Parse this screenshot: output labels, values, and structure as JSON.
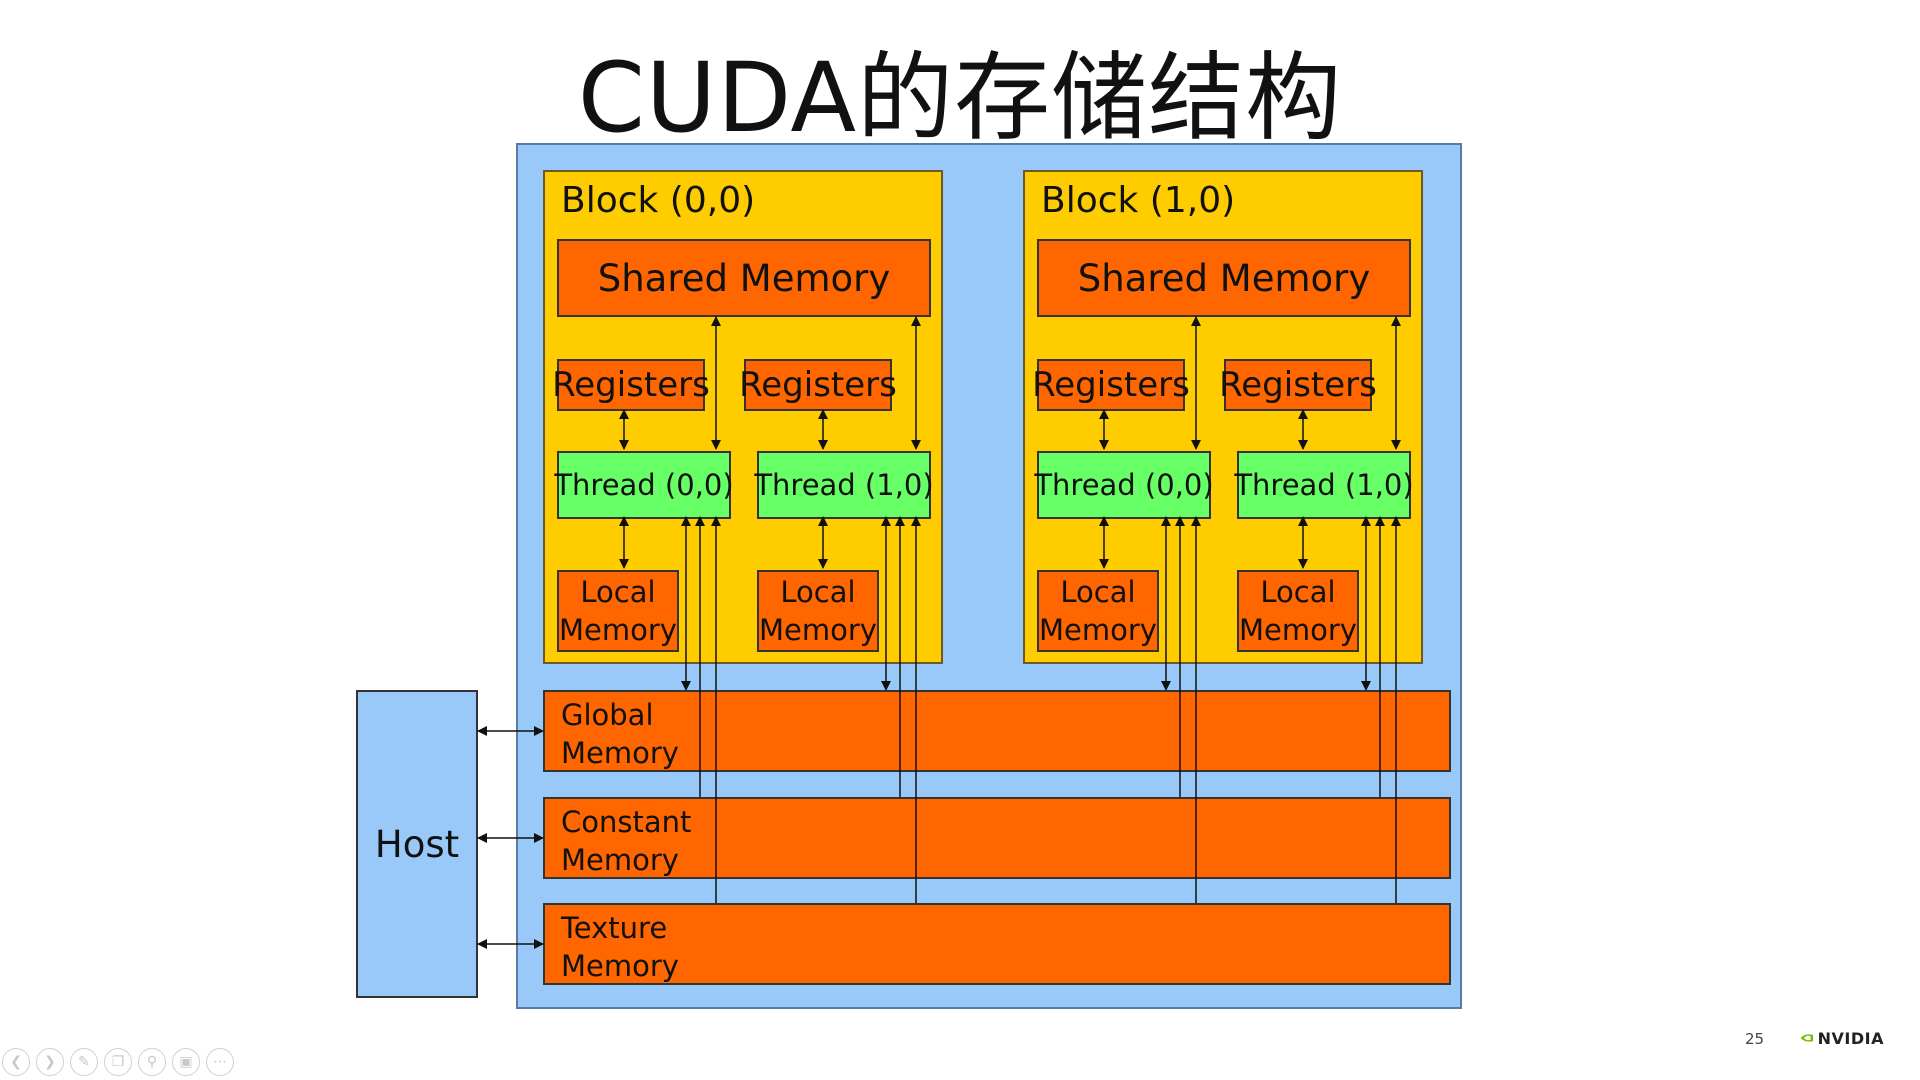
{
  "title": "CUDA的存储结构",
  "blocks": [
    {
      "label": "Block (0,0)",
      "shared": "Shared Memory",
      "threads": [
        {
          "registers": "Registers",
          "thread": "Thread (0,0)",
          "local_line1": "Local",
          "local_line2": "Memory"
        },
        {
          "registers": "Registers",
          "thread": "Thread (1,0)",
          "local_line1": "Local",
          "local_line2": "Memory"
        }
      ]
    },
    {
      "label": "Block (1,0)",
      "shared": "Shared Memory",
      "threads": [
        {
          "registers": "Registers",
          "thread": "Thread (0,0)",
          "local_line1": "Local",
          "local_line2": "Memory"
        },
        {
          "registers": "Registers",
          "thread": "Thread (1,0)",
          "local_line1": "Local",
          "local_line2": "Memory"
        }
      ]
    }
  ],
  "memories": [
    {
      "line1": "Global",
      "line2": "Memory"
    },
    {
      "line1": "Constant",
      "line2": "Memory"
    },
    {
      "line1": "Texture",
      "line2": "Memory"
    }
  ],
  "host": "Host",
  "page_number": "25",
  "brand": "NVIDIA",
  "colors": {
    "device": "#99c9f9",
    "block": "#ffcc00",
    "memory": "#ff6600",
    "thread": "#66ff66",
    "host": "#99c9f9",
    "brand_green": "#76b900"
  },
  "toolbar_icons": [
    "prev-icon",
    "next-icon",
    "pen-icon",
    "copy-icon",
    "zoom-icon",
    "screen-icon",
    "more-icon"
  ]
}
